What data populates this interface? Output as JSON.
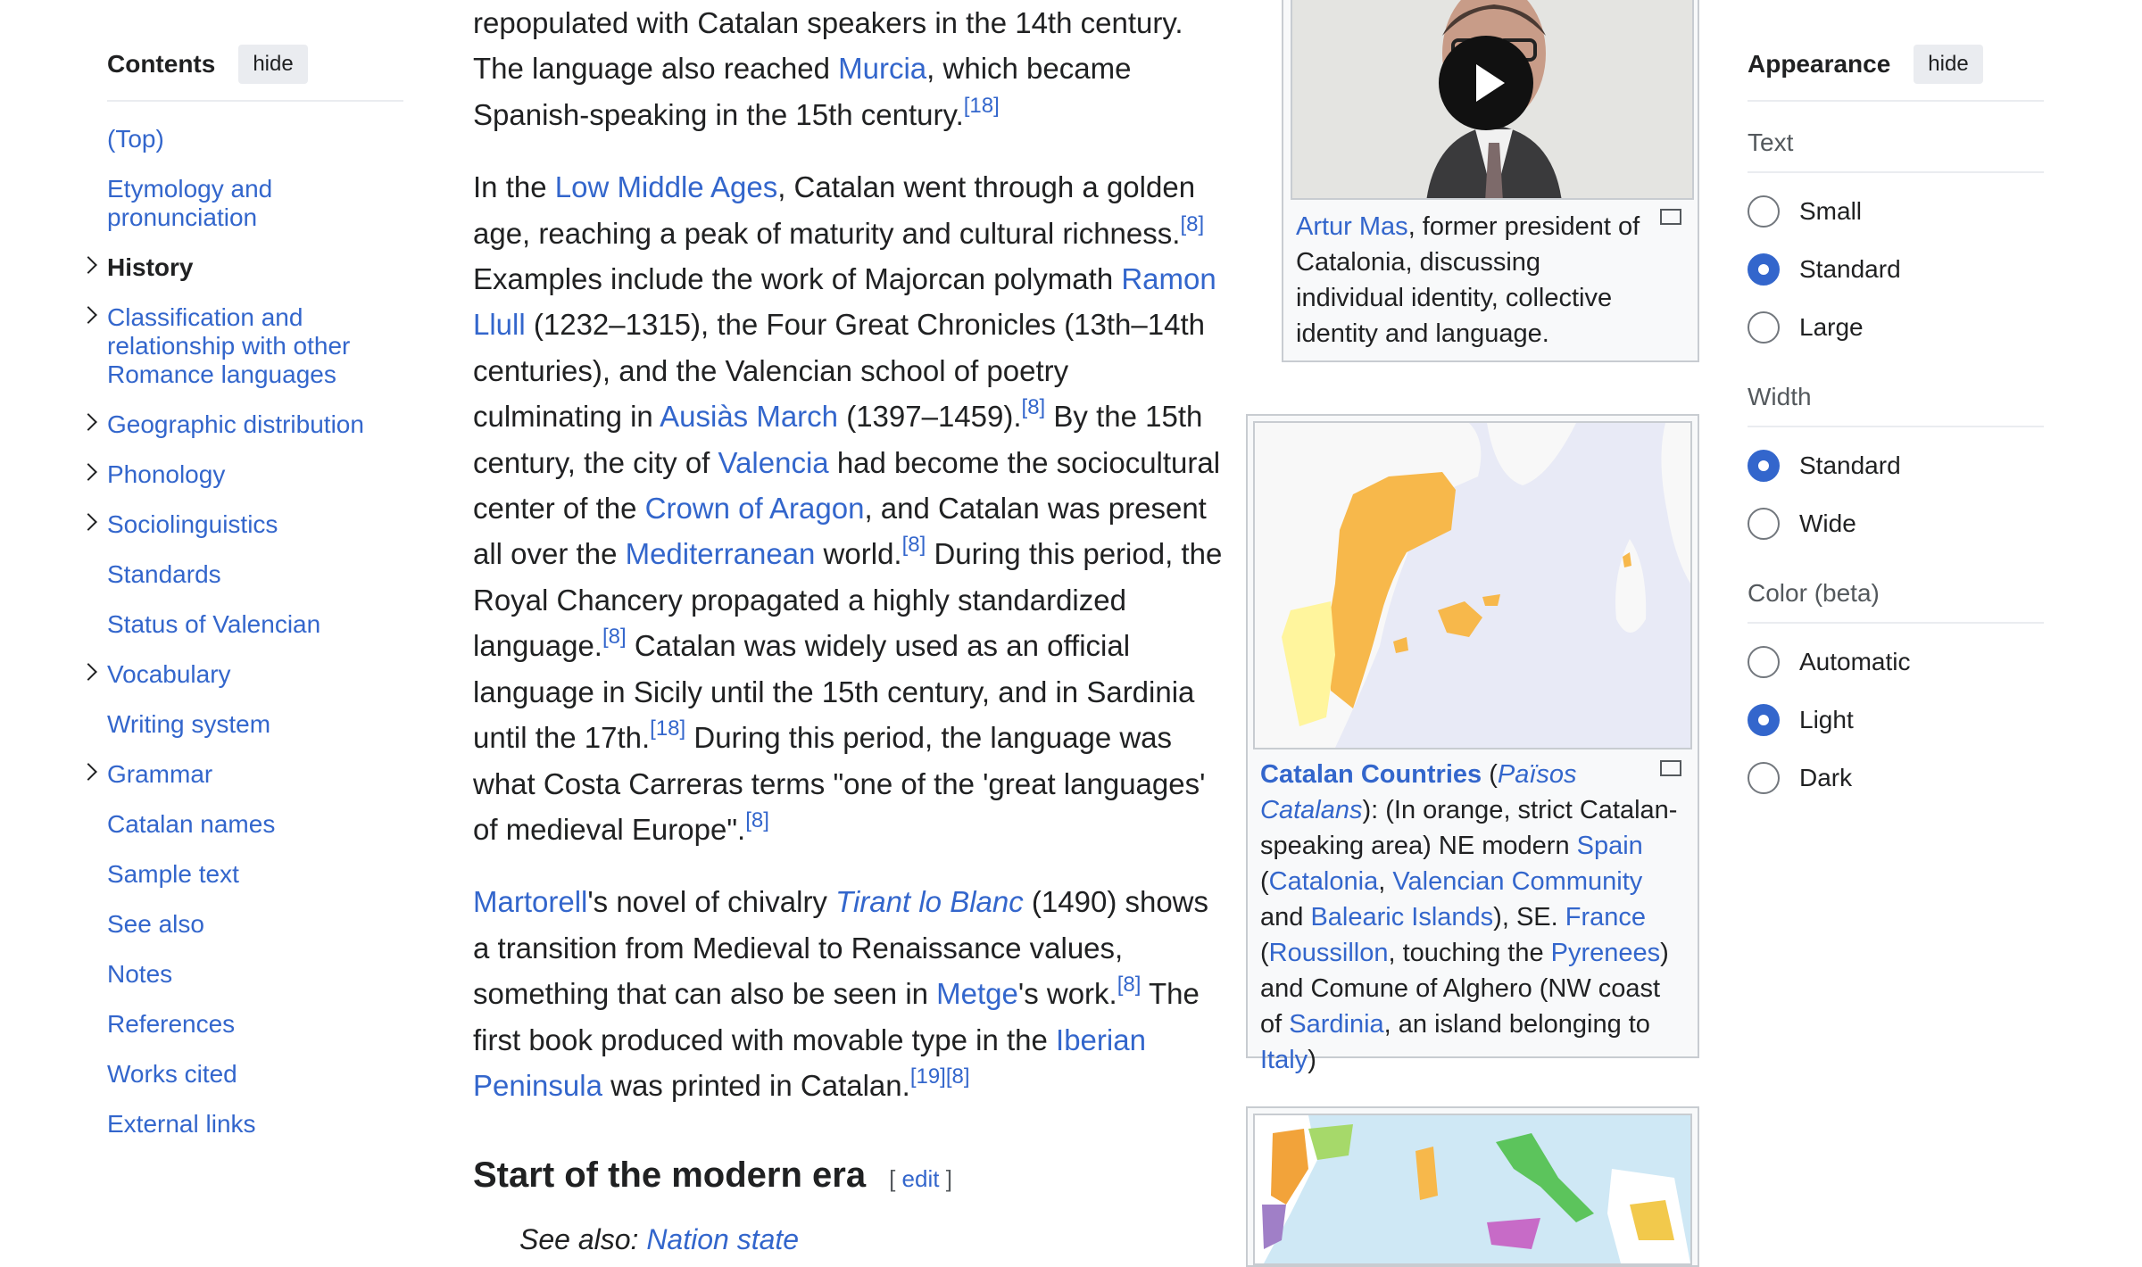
{
  "toc": {
    "title": "Contents",
    "hide_label": "hide",
    "items": [
      {
        "label": "(Top)"
      },
      {
        "label": "Etymology and pronunciation"
      },
      {
        "label": "History"
      },
      {
        "label": "Classification and relationship with other Romance languages"
      },
      {
        "label": "Geographic distribution"
      },
      {
        "label": "Phonology"
      },
      {
        "label": "Sociolinguistics"
      },
      {
        "label": "Standards"
      },
      {
        "label": "Status of Valencian"
      },
      {
        "label": "Vocabulary"
      },
      {
        "label": "Writing system"
      },
      {
        "label": "Grammar"
      },
      {
        "label": "Catalan names"
      },
      {
        "label": "Sample text"
      },
      {
        "label": "See also"
      },
      {
        "label": "Notes"
      },
      {
        "label": "References"
      },
      {
        "label": "Works cited"
      },
      {
        "label": "External links"
      }
    ]
  },
  "article": {
    "p1": {
      "t1": "repopulated with Catalan speakers in the 14th century. The language also reached ",
      "l1": "Murcia",
      "t2": ", which became Spanish-speaking in the 15th century.",
      "r1": "[18]"
    },
    "p2": {
      "t1": "In the ",
      "l1": "Low Middle Ages",
      "t2": ", Catalan went through a golden age, reaching a peak of maturity and cultural richness.",
      "r1": "[8]",
      "t3": " Examples include the work of Majorcan polymath ",
      "l2": "Ramon Llull",
      "t4": " (1232–1315), the Four Great Chronicles (13th–14th centuries), and the Valencian school of poetry culminating in ",
      "l3": "Ausiàs March",
      "t5": " (1397–1459).",
      "r2": "[8]",
      "t6": " By the 15th century, the city of ",
      "l4": "Valencia",
      "t7": " had become the sociocultural center of the ",
      "l5": "Crown of Aragon",
      "t8": ", and Catalan was present all over the ",
      "l6": "Mediterranean",
      "t9": " world.",
      "r3": "[8]",
      "t10": " During this period, the Royal Chancery propagated a highly standardized language.",
      "r4": "[8]",
      "t11": " Catalan was widely used as an official language in Sicily until the 15th century, and in Sardinia until the 17th.",
      "r5": "[18]",
      "t12": " During this period, the language was what Costa Carreras terms \"one of the 'great languages' of medieval Europe\".",
      "r6": "[8]"
    },
    "p3": {
      "l1": "Martorell",
      "t1": "'s novel of chivalry ",
      "l2": "Tirant lo Blanc",
      "t2": " (1490) shows a transition from Medieval to Renaissance values, something that can also be seen in ",
      "l3": "Metge",
      "t3": "'s work.",
      "r1": "[8]",
      "t4": " The first book produced with movable type in the ",
      "l4": "Iberian Peninsula",
      "t5": " was printed in Catalan.",
      "r2": "[19]",
      "r3": "[8]"
    },
    "section": {
      "title": "Start of the modern era",
      "edit_open": "[",
      "edit_label": "edit",
      "edit_close": "]",
      "see_also_prefix": "See also: ",
      "see_also_link": "Nation state"
    }
  },
  "figure_video": {
    "caption_link": "Artur Mas",
    "caption_text": ", former president of Catalonia, discussing individual identity, collective identity and language."
  },
  "figure_map": {
    "caption_link_bold": "Catalan Countries",
    "open_paren": " (",
    "caption_italic": "Països Catalans",
    "t1": "): (In orange, strict Catalan-speaking area) NE modern ",
    "l_spain": "Spain",
    "t2": " (",
    "l_catalonia": "Catalonia",
    "t3": ", ",
    "l_valencian": "Valencian Community",
    "t4": " and ",
    "l_balearic": "Balearic Islands",
    "t5": "), SE. ",
    "l_france": "France",
    "t6": " (",
    "l_roussillon": "Roussillon",
    "t7": ", touching the ",
    "l_pyrenees": "Pyrenees",
    "t8": ") and Comune of Alghero (NW coast of ",
    "l_sardinia": "Sardinia",
    "t9": ", an island belonging to ",
    "l_italy": "Italy",
    "t10": ")"
  },
  "appearance": {
    "title": "Appearance",
    "hide_label": "hide",
    "text_label": "Text",
    "text_options": [
      "Small",
      "Standard",
      "Large"
    ],
    "text_selected": "Standard",
    "width_label": "Width",
    "width_options": [
      "Standard",
      "Wide"
    ],
    "width_selected": "Standard",
    "color_label": "Color (beta)",
    "color_options": [
      "Automatic",
      "Light",
      "Dark"
    ],
    "color_selected": "Light"
  },
  "colors": {
    "link": "#3366cc",
    "text": "#202122",
    "map_sea": "#e8eaf6",
    "catalan_orange": "#f7b84b"
  }
}
